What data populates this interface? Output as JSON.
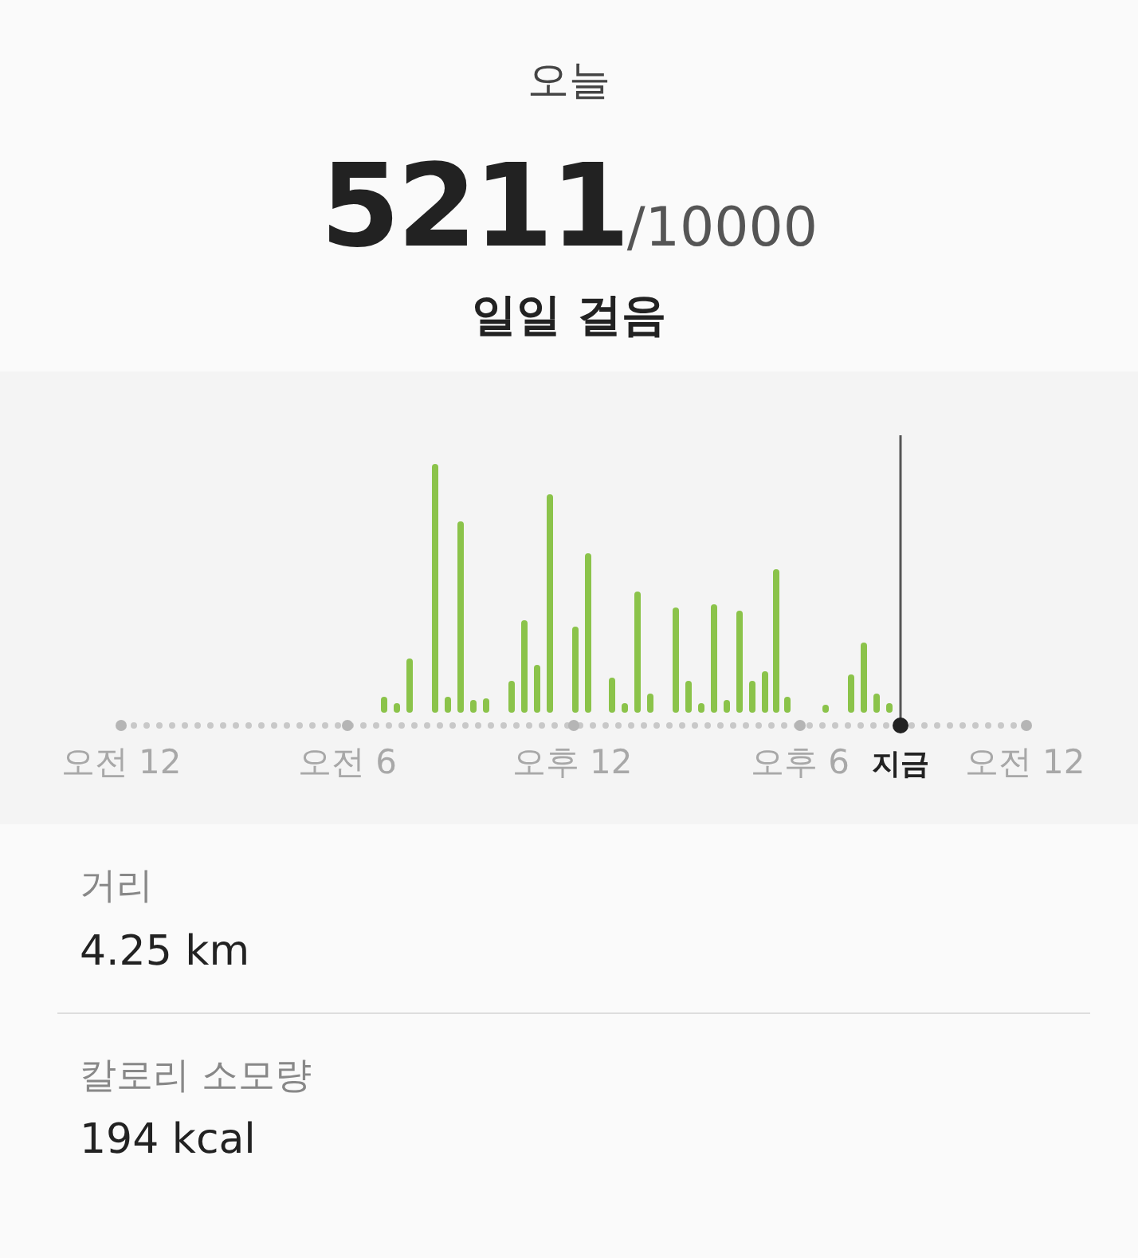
{
  "header": {
    "title": "오늘",
    "steps": "5211",
    "goal": "/10000",
    "label": "일일 걸음"
  },
  "chart": {
    "axis_labels": [
      {
        "text": "오전 12",
        "kind": "tick"
      },
      {
        "text": "오전 6",
        "kind": "tick"
      },
      {
        "text": "오후 12",
        "kind": "tick"
      },
      {
        "text": "오후 6",
        "kind": "tick"
      },
      {
        "text": "지금",
        "kind": "now"
      },
      {
        "text": "오전 12",
        "kind": "tick"
      }
    ]
  },
  "stats": [
    {
      "label": "거리",
      "value": "4.25 km"
    },
    {
      "label": "칼로리 소모량",
      "value": "194 kcal"
    }
  ]
}
